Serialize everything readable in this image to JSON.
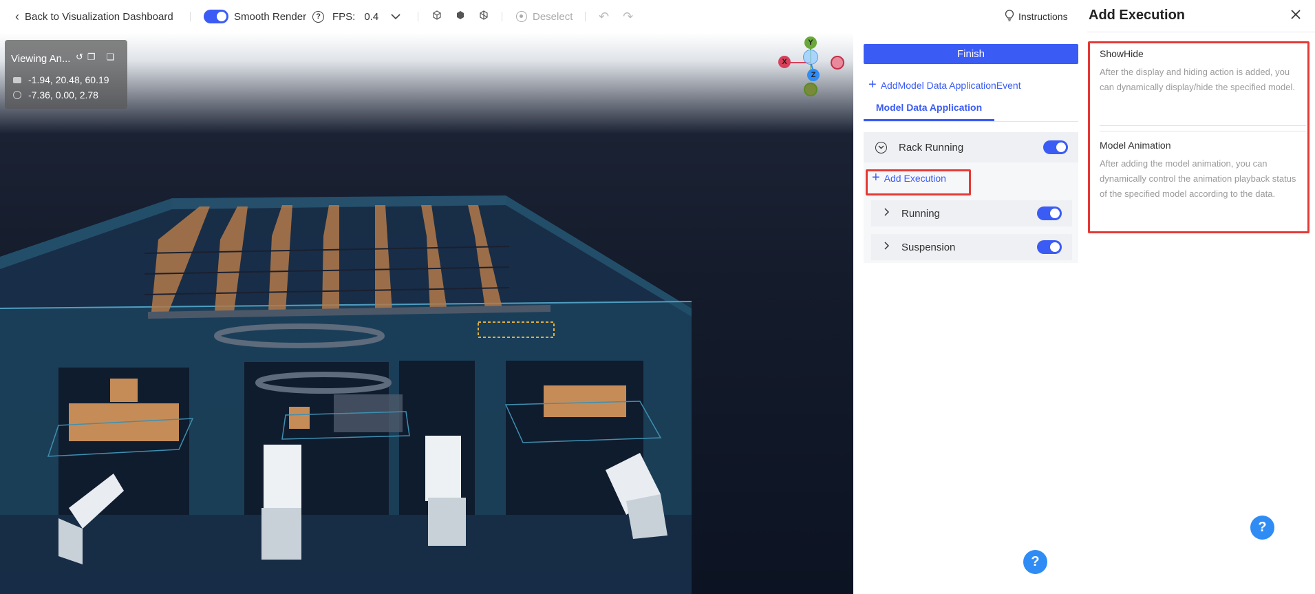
{
  "topbar": {
    "back_label": "Back to Visualization Dashboard",
    "smooth_render_label": "Smooth Render",
    "fps_label": "FPS:",
    "fps_value": "0.4",
    "deselect_label": "Deselect",
    "instructions_label": "Instructions"
  },
  "viewport": {
    "title": "Viewing An...",
    "camera_coords": "-1.94, 20.48, 60.19",
    "target_coords": "-7.36, 0.00, 2.78",
    "axes": {
      "x": "X",
      "y": "Y",
      "z": "Z"
    }
  },
  "middle_panel": {
    "finish_label": "Finish",
    "add_event_label": "AddModel Data ApplicationEvent",
    "tab_label": "Model Data Application",
    "group_label": "Rack Running",
    "add_execution_label": "Add Execution",
    "items": [
      {
        "label": "Running"
      },
      {
        "label": "Suspension"
      }
    ]
  },
  "right_panel": {
    "title": "Add Execution",
    "cards": [
      {
        "title": "ShowHide",
        "description": "After the display and hiding action is added, you can dynamically display/hide the specified model."
      },
      {
        "title": "Model Animation",
        "description": "After adding the model animation, you can dynamically control the animation playback status of the specified model according to the data."
      }
    ]
  },
  "help_label": "?",
  "colors": {
    "accent": "#3b5bf5",
    "highlight": "#e53935",
    "help": "#2f8cf5"
  }
}
